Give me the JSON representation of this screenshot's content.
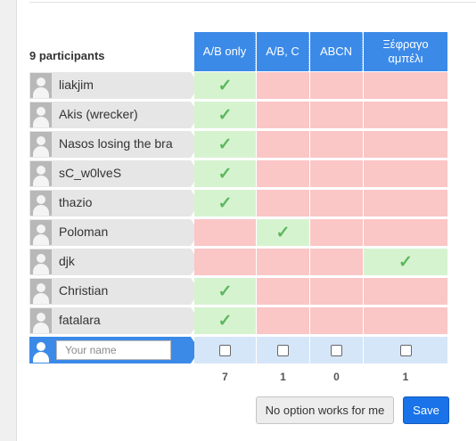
{
  "participants_label": "9 participants",
  "options": [
    {
      "label": "A/B only"
    },
    {
      "label": "A/B, C"
    },
    {
      "label": "ABCN"
    },
    {
      "label": "Ξέφραγο αμπέλι"
    }
  ],
  "participants": [
    {
      "name": "liakjim",
      "votes": [
        "yes",
        "no",
        "no",
        "no"
      ]
    },
    {
      "name": "Akis (wrecker)",
      "votes": [
        "yes",
        "no",
        "no",
        "no"
      ]
    },
    {
      "name": "Nasos losing the bra",
      "votes": [
        "yes",
        "no",
        "no",
        "no"
      ]
    },
    {
      "name": "sC_w0lveS",
      "votes": [
        "yes",
        "no",
        "no",
        "no"
      ]
    },
    {
      "name": "thazio",
      "votes": [
        "yes",
        "no",
        "no",
        "no"
      ]
    },
    {
      "name": "Poloman",
      "votes": [
        "no",
        "yes",
        "no",
        "no"
      ]
    },
    {
      "name": "djk",
      "votes": [
        "no",
        "no",
        "no",
        "yes"
      ]
    },
    {
      "name": "Christian",
      "votes": [
        "yes",
        "no",
        "no",
        "no"
      ]
    },
    {
      "name": "fatalara",
      "votes": [
        "yes",
        "no",
        "no",
        "no"
      ]
    }
  ],
  "name_input": {
    "placeholder": "Your name",
    "value": ""
  },
  "totals": [
    "7",
    "1",
    "0",
    "1"
  ],
  "buttons": {
    "no_option": "No option works for me",
    "save": "Save"
  },
  "check_glyph": "✓",
  "colors": {
    "header": "#3b8ae8",
    "yes": "#d6f3d0",
    "no": "#fbc6c6",
    "input_row": "#d6e6f9",
    "save": "#1a73e8"
  }
}
